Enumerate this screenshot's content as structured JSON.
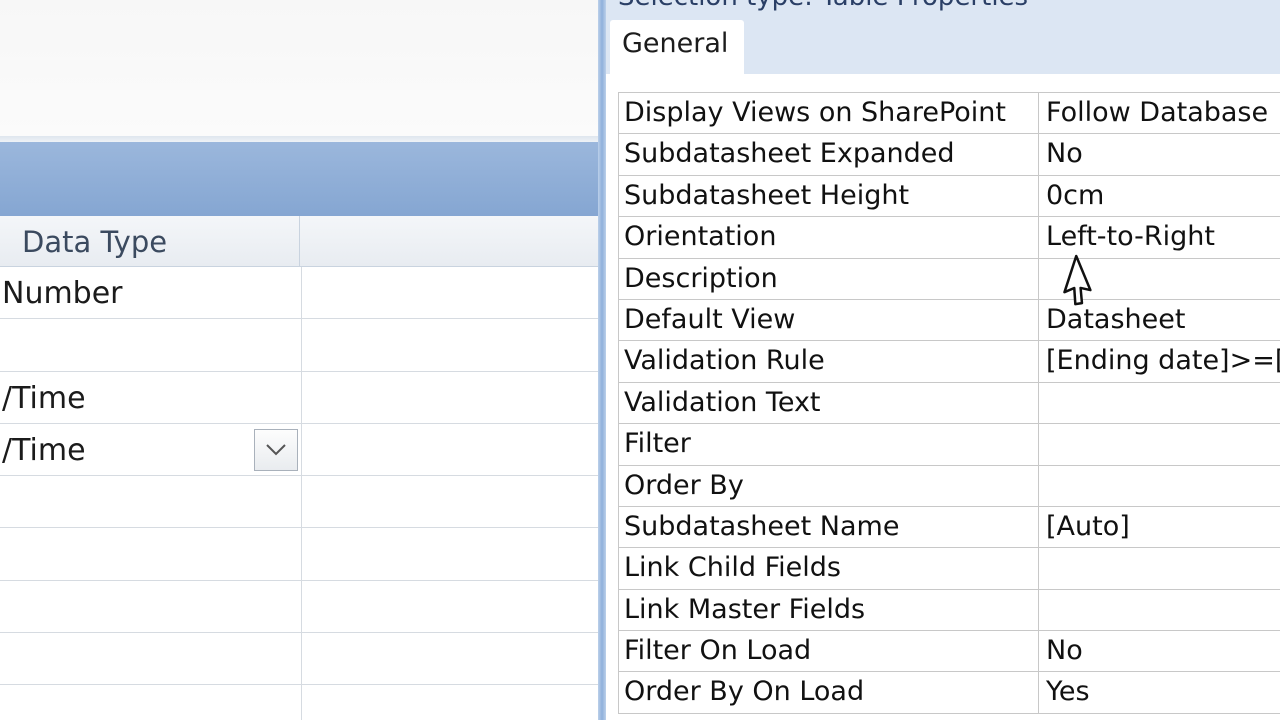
{
  "colors": {
    "title_bar": "#8eacd6",
    "splitter": "#8fb0db",
    "property_panel_bg": "#dce6f3",
    "grid_line": "#c8c8c8"
  },
  "design_grid": {
    "header": {
      "data_type": "Data Type"
    },
    "rows": [
      {
        "type": "Number"
      },
      {
        "type": ""
      },
      {
        "type": "/Time"
      },
      {
        "type": "/Time",
        "dropdown_icon": "chevron-down-icon"
      },
      {
        "type": ""
      },
      {
        "type": ""
      },
      {
        "type": ""
      },
      {
        "type": ""
      },
      {
        "type": ""
      }
    ]
  },
  "property_sheet": {
    "selection_type": "Selection type:  Table Properties",
    "tab": "General",
    "properties": [
      {
        "label": "Display Views on SharePoint",
        "value": "Follow Database"
      },
      {
        "label": "Subdatasheet Expanded",
        "value": "No"
      },
      {
        "label": "Subdatasheet Height",
        "value": "0cm"
      },
      {
        "label": "Orientation",
        "value": "Left-to-Right"
      },
      {
        "label": "Description",
        "value": ""
      },
      {
        "label": "Default View",
        "value": "Datasheet"
      },
      {
        "label": "Validation Rule",
        "value": "[Ending date]>=[Starting date]"
      },
      {
        "label": "Validation Text",
        "value": ""
      },
      {
        "label": "Filter",
        "value": ""
      },
      {
        "label": "Order By",
        "value": ""
      },
      {
        "label": "Subdatasheet Name",
        "value": "[Auto]"
      },
      {
        "label": "Link Child Fields",
        "value": ""
      },
      {
        "label": "Link Master Fields",
        "value": ""
      },
      {
        "label": "Filter On Load",
        "value": "No"
      },
      {
        "label": "Order By On Load",
        "value": "Yes"
      }
    ]
  },
  "cursor_icon": "mouse-pointer-icon"
}
